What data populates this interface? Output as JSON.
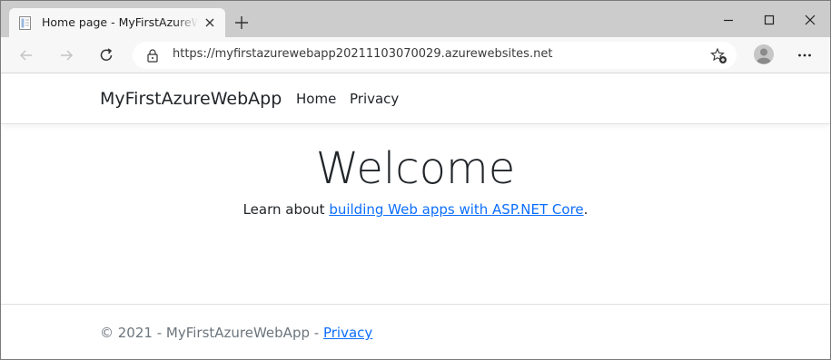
{
  "browser": {
    "tab_title": "Home page - MyFirstAzureWebApp",
    "url": "https://myfirstazurewebapp20211103070029.azurewebsites.net"
  },
  "icons": {
    "favicon": "page-icon",
    "tab_close": "close-icon",
    "new_tab": "plus-icon",
    "minimize": "minimize-icon",
    "maximize": "maximize-icon",
    "close_window": "close-icon",
    "back": "arrow-left-icon",
    "forward": "arrow-right-icon",
    "refresh": "refresh-icon",
    "lock": "lock-icon",
    "add_favorite": "star-plus-icon",
    "profile": "avatar-icon",
    "more": "ellipsis-icon"
  },
  "site": {
    "brand": "MyFirstAzureWebApp",
    "nav": [
      "Home",
      "Privacy"
    ]
  },
  "main": {
    "heading": "Welcome",
    "learn_prefix": "Learn about ",
    "learn_link": "building Web apps with ASP.NET Core",
    "learn_suffix": "."
  },
  "footer": {
    "text": "© 2021 - MyFirstAzureWebApp - ",
    "link": "Privacy"
  },
  "colors": {
    "tabstrip": "#cccccc",
    "toolbar": "#f7f7f7",
    "link": "#0d6efd",
    "text": "#212529",
    "muted": "#6c757d"
  }
}
